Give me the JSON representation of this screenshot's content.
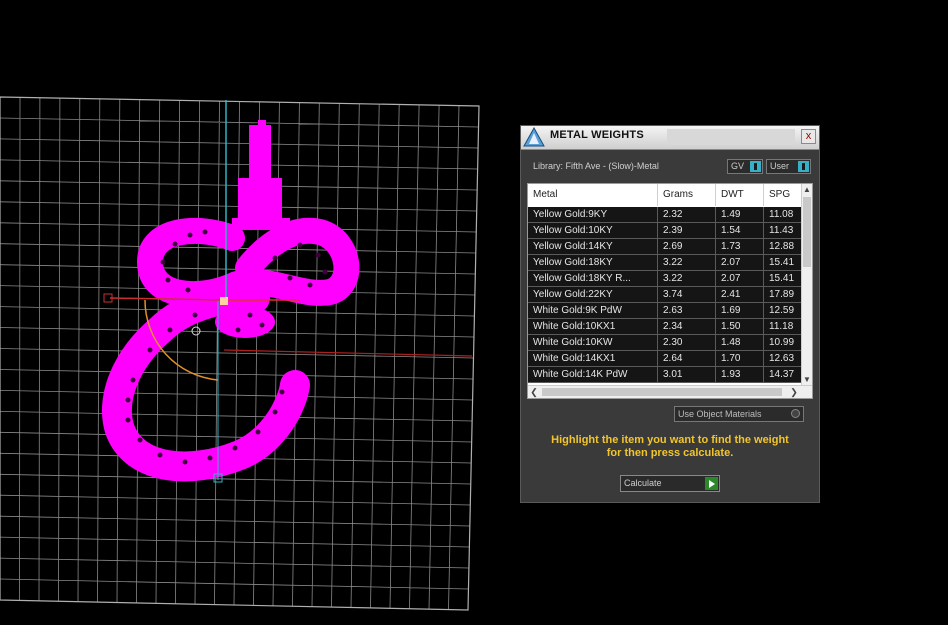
{
  "panel": {
    "title": "METAL WEIGHTS",
    "close_label": "x",
    "library": "Library: Fifth Ave - (Slow)-Metal",
    "gv_label": "GV",
    "user_label": "User",
    "use_object_materials": "Use Object Materials",
    "hint_line1": "Highlight the item you want to find the weight",
    "hint_line2": "for then press calculate.",
    "calculate_label": "Calculate"
  },
  "table": {
    "headers": [
      "Metal",
      "Grams",
      "DWT",
      "SPG"
    ],
    "rows": [
      [
        "Yellow Gold:9KY",
        "2.32",
        "1.49",
        "11.08"
      ],
      [
        "Yellow Gold:10KY",
        "2.39",
        "1.54",
        "11.43"
      ],
      [
        "Yellow Gold:14KY",
        "2.69",
        "1.73",
        "12.88"
      ],
      [
        "Yellow Gold:18KY",
        "3.22",
        "2.07",
        "15.41"
      ],
      [
        "Yellow Gold:18KY R...",
        "3.22",
        "2.07",
        "15.41"
      ],
      [
        "Yellow Gold:22KY",
        "3.74",
        "2.41",
        "17.89"
      ],
      [
        "White Gold:9K PdW",
        "2.63",
        "1.69",
        "12.59"
      ],
      [
        "White Gold:10KX1",
        "2.34",
        "1.50",
        "11.18"
      ],
      [
        "White Gold:10KW",
        "2.30",
        "1.48",
        "10.99"
      ],
      [
        "White Gold:14KX1",
        "2.64",
        "1.70",
        "12.63"
      ],
      [
        "White Gold:14K PdW",
        "3.01",
        "1.93",
        "14.37"
      ]
    ]
  },
  "colors": {
    "object": "#ff00ff",
    "grid": "#8a8a8a",
    "hint": "#f2c62b",
    "toggle_accent": "#35b0c8"
  }
}
